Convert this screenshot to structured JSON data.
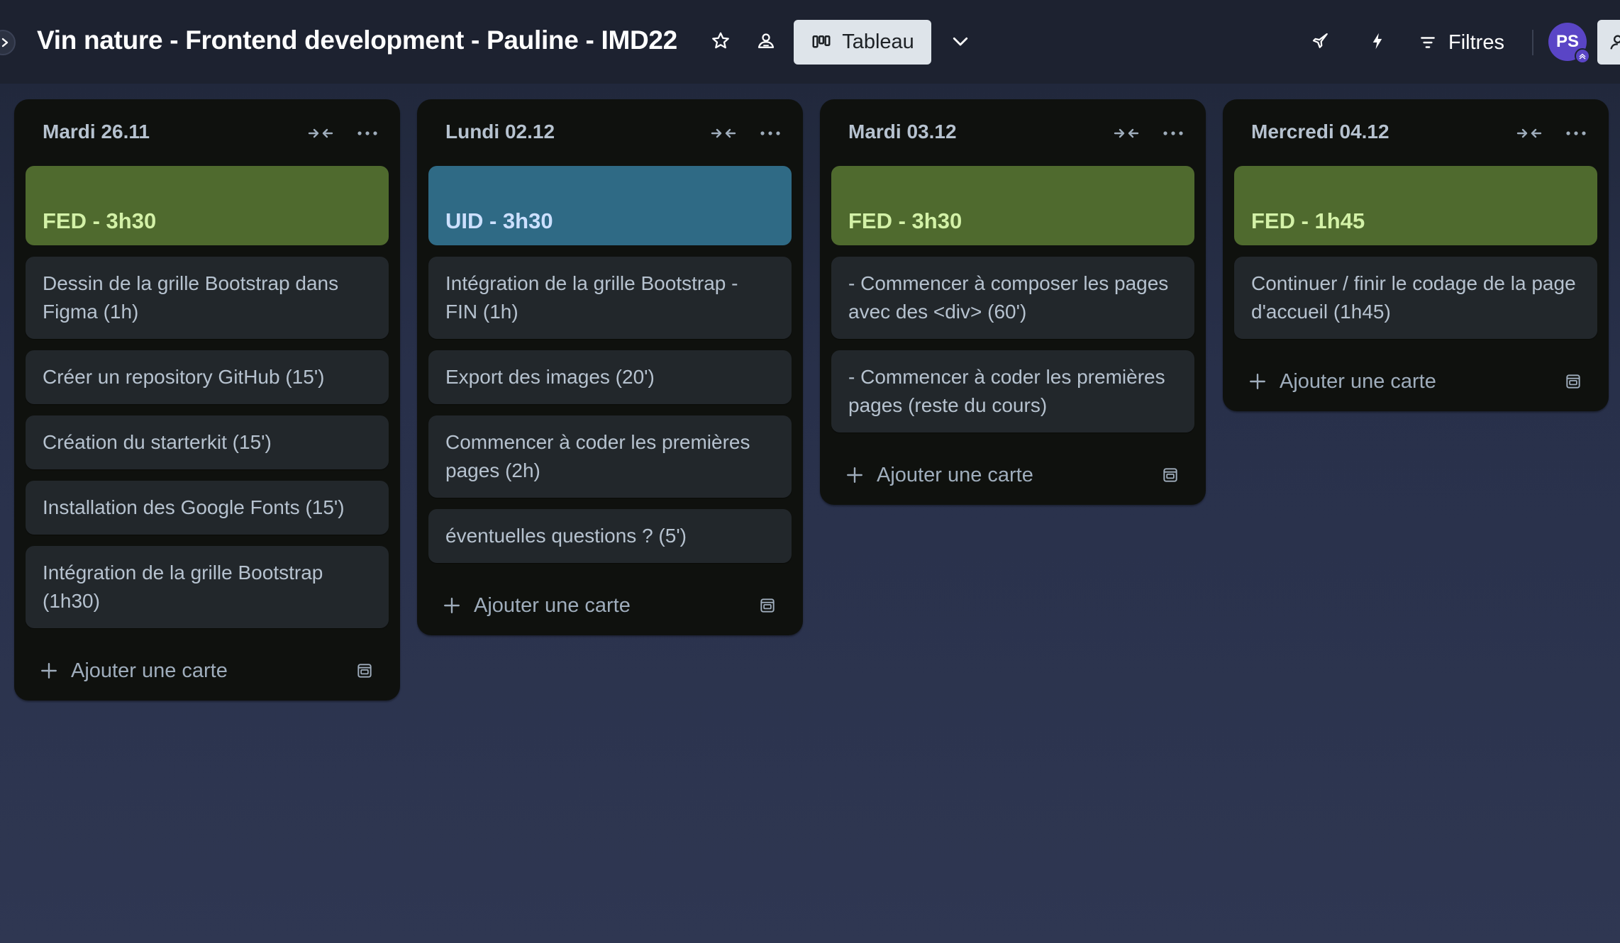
{
  "header": {
    "board_title": "Vin nature - Frontend development - Pauline - IMD22",
    "view_label": "Tableau",
    "filters_label": "Filtres",
    "avatar_initials": "PS"
  },
  "colors": {
    "fed_cover": "#4f6a2e",
    "fed_text": "#d3f1a7",
    "uid_cover": "#2f6a85",
    "uid_text": "#cce0ff"
  },
  "lists": [
    {
      "title": "Mardi 26.11",
      "cover": {
        "label": "FED - 3h30",
        "kind": "fed"
      },
      "cards": [
        "Dessin de la grille Bootstrap dans Figma (1h)",
        "Créer un repository GitHub (15')",
        "Création du starterkit (15')",
        "Installation des Google Fonts (15')",
        "Intégration de la grille Bootstrap (1h30)"
      ],
      "add_label": "Ajouter une carte"
    },
    {
      "title": "Lundi 02.12",
      "cover": {
        "label": "UID - 3h30",
        "kind": "uid"
      },
      "cards": [
        "Intégration de la grille Bootstrap - FIN (1h)",
        "Export des images (20')",
        "Commencer à coder les premières pages (2h)",
        "éventuelles questions ? (5')"
      ],
      "add_label": "Ajouter une carte"
    },
    {
      "title": "Mardi 03.12",
      "cover": {
        "label": "FED - 3h30",
        "kind": "fed"
      },
      "cards": [
        "- Commencer à composer les pages avec des <div> (60')",
        "- Commencer à coder les premières pages (reste du cours)"
      ],
      "add_label": "Ajouter une carte"
    },
    {
      "title": "Mercredi 04.12",
      "cover": {
        "label": "FED - 1h45",
        "kind": "fed"
      },
      "cards": [
        "Continuer / finir le codage de la page d'accueil (1h45)"
      ],
      "add_label": "Ajouter une carte"
    }
  ]
}
